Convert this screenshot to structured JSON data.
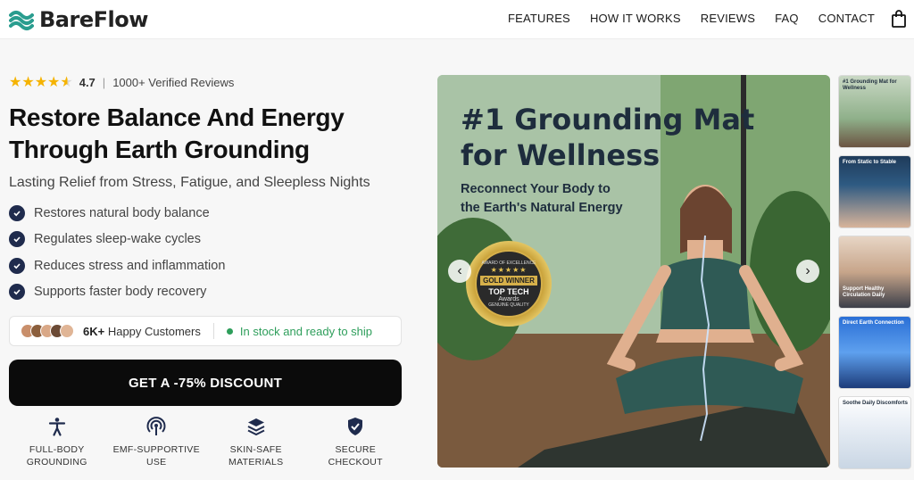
{
  "header": {
    "brand": "BareFlow",
    "nav": [
      "FEATURES",
      "HOW IT WORKS",
      "REVIEWS",
      "FAQ",
      "CONTACT"
    ],
    "cart_icon": "shopping-bag-icon"
  },
  "rating": {
    "value": "4.7",
    "stars": 4.7,
    "reviews": "1000+ Verified Reviews"
  },
  "headline": "Restore Balance And Energy Through Earth Grounding",
  "subheadline": "Lasting Relief from Stress, Fatigue, and Sleepless Nights",
  "benefits": [
    "Restores natural body balance",
    "Regulates sleep-wake cycles",
    "Reduces stress and inflammation",
    "Supports faster body recovery"
  ],
  "social": {
    "happy_count": "6K+",
    "happy_label": " Happy Customers",
    "stock": "In stock and ready to ship"
  },
  "cta": "GET A -75% DISCOUNT",
  "features": [
    {
      "line1": "FULL-BODY",
      "line2": "GROUNDING",
      "icon": "person-icon"
    },
    {
      "line1": "EMF-SUPPORTIVE",
      "line2": "USE",
      "icon": "signal-icon"
    },
    {
      "line1": "SKIN-SAFE",
      "line2": "MATERIALS",
      "icon": "layers-icon"
    },
    {
      "line1": "SECURE",
      "line2": "CHECKOUT",
      "icon": "shield-check-icon"
    }
  ],
  "hero": {
    "title_line1": "#1 Grounding Mat",
    "title_line2": "for Wellness",
    "subtitle_line1": "Reconnect Your Body to",
    "subtitle_line2": "the Earth's Natural Energy",
    "badge": {
      "ring_top": "AWARD OF EXCELLENCE",
      "stars": "★★★★★",
      "gold": "GOLD WINNER",
      "tech": "TOP TECH",
      "awards": "Awards",
      "ring_bottom": "GENUINE QUALITY"
    }
  },
  "thumbnails": [
    "#1 Grounding Mat for Wellness",
    "From Static to Stable",
    "Support Healthy Circulation Daily",
    "Direct Earth Connection",
    "Soothe Daily Discomforts"
  ],
  "colors": {
    "accent_dark": "#1f2b4d",
    "stock_green": "#2e9e5b",
    "star": "#f5b301",
    "cta_bg": "#0b0b0b"
  }
}
